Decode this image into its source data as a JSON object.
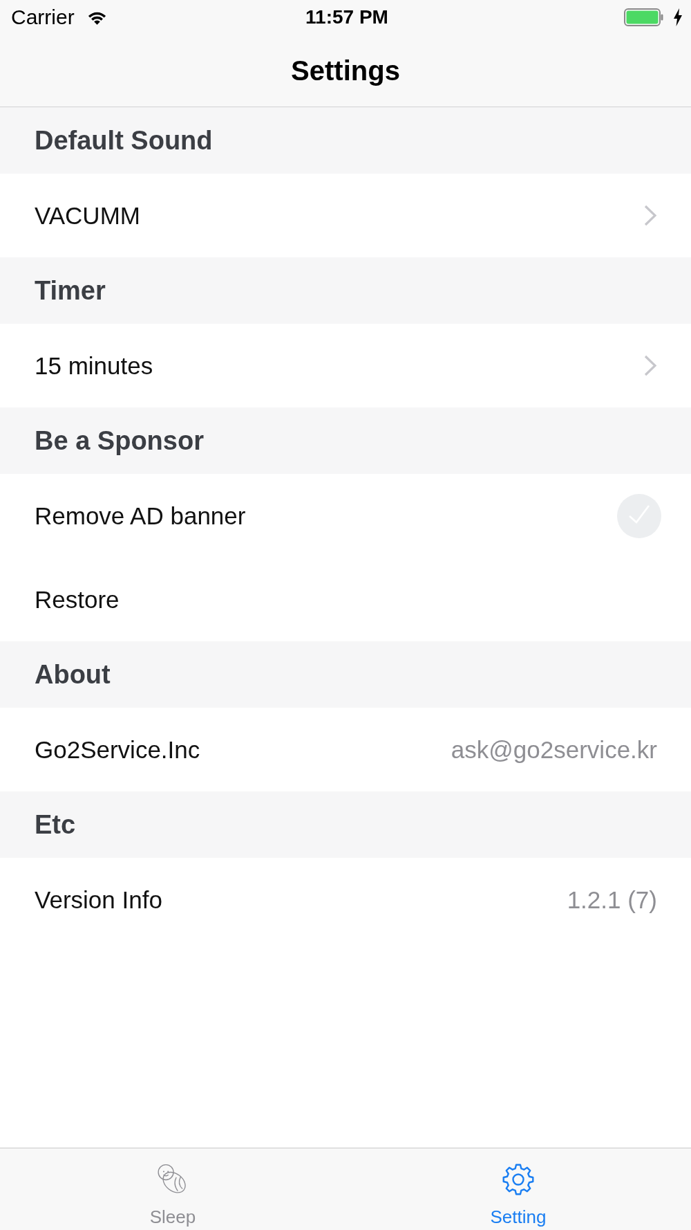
{
  "status_bar": {
    "carrier": "Carrier",
    "time": "11:57 PM",
    "charging": true
  },
  "nav_bar": {
    "title": "Settings"
  },
  "sections": [
    {
      "header": "Default Sound",
      "rows": [
        {
          "kind": "disclosure",
          "label": "VACUMM"
        }
      ]
    },
    {
      "header": "Timer",
      "rows": [
        {
          "kind": "disclosure",
          "label": "15 minutes"
        }
      ]
    },
    {
      "header": "Be a Sponsor",
      "rows": [
        {
          "kind": "check",
          "label": "Remove AD banner",
          "checked": false
        },
        {
          "kind": "plain",
          "label": "Restore"
        }
      ]
    },
    {
      "header": "About",
      "rows": [
        {
          "kind": "detail",
          "label": "Go2Service.Inc",
          "value": "ask@go2service.kr"
        }
      ]
    },
    {
      "header": "Etc",
      "rows": [
        {
          "kind": "detail",
          "label": "Version Info",
          "value": "1.2.1 (7)"
        }
      ]
    }
  ],
  "tab_bar": {
    "tabs": [
      {
        "label": "Sleep",
        "selected": false
      },
      {
        "label": "Setting",
        "selected": true
      }
    ]
  }
}
